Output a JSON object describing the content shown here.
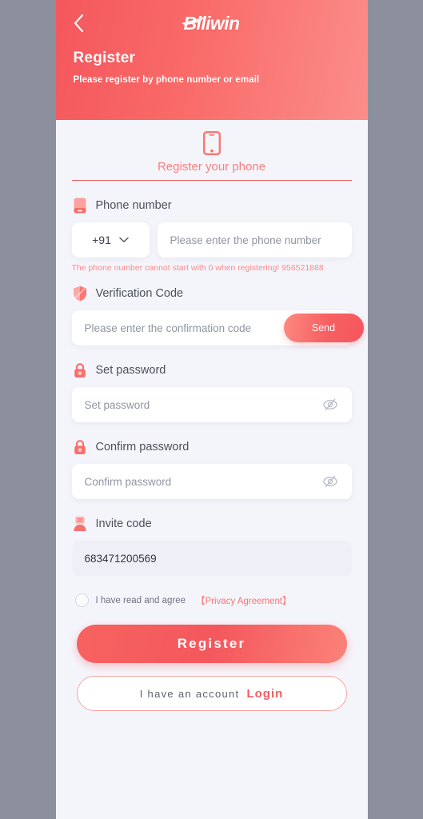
{
  "header": {
    "back_icon": "chevron-left-icon",
    "logo_text": "Biliwin",
    "title": "Register",
    "subtitle": "Please register by phone number or email"
  },
  "tab": {
    "icon": "smartphone-icon",
    "label": "Register your phone"
  },
  "phone_field": {
    "icon": "phone-icon",
    "label": "Phone number",
    "country_code": "+91",
    "chevron_icon": "chevron-down-icon",
    "placeholder": "Please enter the phone number",
    "value": "",
    "error": "The phone number cannot start with 0 when registering! 956521888"
  },
  "verification_field": {
    "icon": "shield-icon",
    "label": "Verification Code",
    "placeholder": "Please enter the confirmation code",
    "value": "",
    "send_label": "Send"
  },
  "password_field": {
    "icon": "lock-icon",
    "label": "Set password",
    "placeholder": "Set password",
    "value": "",
    "toggle_icon": "eye-off-icon"
  },
  "confirm_password_field": {
    "icon": "lock-icon",
    "label": "Confirm password",
    "placeholder": "Confirm password",
    "value": "",
    "toggle_icon": "eye-off-icon"
  },
  "invite_field": {
    "icon": "user-card-icon",
    "label": "Invite code",
    "placeholder": "",
    "value": "683471200569"
  },
  "agreement": {
    "checked": false,
    "text": "I have read and agree",
    "link": "【Privacy Agreement】"
  },
  "actions": {
    "register_label": "Register",
    "login_prefix": "I have an account",
    "login_label": "Login"
  },
  "colors": {
    "brand_red": "#f4575d",
    "brand_light": "#fb8d8a",
    "page_bg": "#f4f5fb",
    "frame_bg": "#8c8f9c",
    "error_text": "#fb8b89",
    "label_text": "#4b5059",
    "placeholder": "#9195a1"
  }
}
